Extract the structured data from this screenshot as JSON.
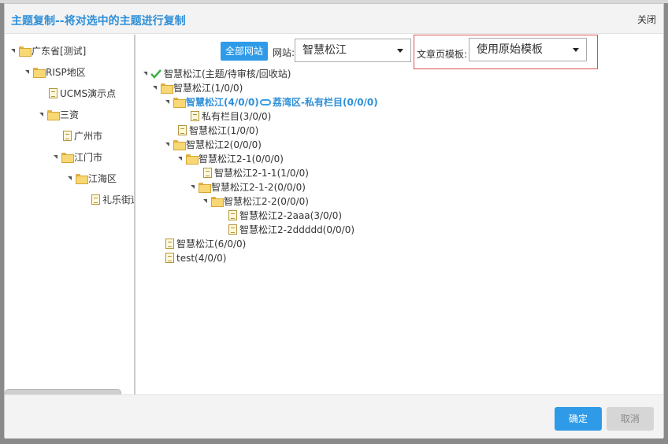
{
  "dialog": {
    "title": "主题复制--将对选中的主题进行复制",
    "close_label": "关闭"
  },
  "left_tree": {
    "items": [
      {
        "label": "广东省[测试]"
      },
      {
        "label": "RISP地区"
      },
      {
        "label": "UCMS演示点"
      },
      {
        "label": "三资"
      },
      {
        "label": "广州市"
      },
      {
        "label": "江门市"
      },
      {
        "label": "江海区"
      },
      {
        "label": "礼乐街道"
      }
    ]
  },
  "toolbar": {
    "all_sites_button": "全部网站",
    "site_label": "网站:",
    "site_value": "智慧松江",
    "template_label": "文章页模板:",
    "template_value": "使用原始模板"
  },
  "topic_tree": {
    "root": "智慧松江(主题/待审核/回收站)",
    "items": [
      {
        "label": "智慧松江(1/0/0)"
      },
      {
        "label": "智慧松江(4/0/0)",
        "link": "荔湾区-私有栏目(0/0/0)"
      },
      {
        "label": "私有栏目(3/0/0)"
      },
      {
        "label": "智慧松江(1/0/0)"
      },
      {
        "label": "智慧松江2(0/0/0)"
      },
      {
        "label": "智慧松江2-1(0/0/0)"
      },
      {
        "label": "智慧松江2-1-1(1/0/0)"
      },
      {
        "label": "智慧松江2-1-2(0/0/0)"
      },
      {
        "label": "智慧松江2-2(0/0/0)"
      },
      {
        "label": "智慧松江2-2aaa(3/0/0)"
      },
      {
        "label": "智慧松江2-2ddddd(0/0/0)"
      },
      {
        "label": "智慧松江(6/0/0)"
      },
      {
        "label": "test(4/0/0)"
      }
    ]
  },
  "footer": {
    "ok_label": "确定",
    "cancel_label": "取消"
  },
  "colors": {
    "accent": "#2f9be8",
    "title": "#2f8fd8",
    "highlight_box": "#d9534f"
  }
}
